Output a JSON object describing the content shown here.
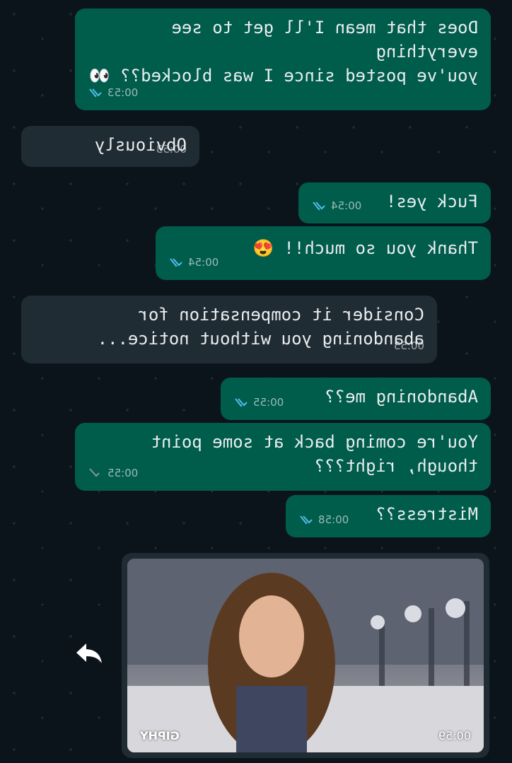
{
  "messages": [
    {
      "side": "out",
      "text": "Does that mean I'll get to see everything\nyou've posted since I was blocked?? 👀",
      "time": "00:53",
      "read": true
    },
    {
      "side": "in",
      "text": "Obviously",
      "time": "00:53"
    },
    {
      "side": "out",
      "text": "Fuck yes!",
      "time": "00:54",
      "read": true
    },
    {
      "side": "out",
      "text": "Thank you so much!! 😍",
      "time": "00:54",
      "read": true
    },
    {
      "side": "in",
      "text": "Consider it compensation for\nabandoning you without notice...",
      "time": "00:55"
    },
    {
      "side": "out",
      "text": "Abandoning me??",
      "time": "00:55",
      "read": true
    },
    {
      "side": "out",
      "text": "You're coming back at some point\nthough, right???",
      "time": "00:55",
      "read": false
    },
    {
      "side": "out",
      "text": "Mistress??",
      "time": "00:58",
      "read": true
    }
  ],
  "gif": {
    "time": "00:59",
    "badge": "GIPHY"
  },
  "icons": {
    "forward": "forward-arrow-icon",
    "read_receipt": "double-check-icon",
    "sent_receipt": "single-check-icon"
  },
  "colors": {
    "outgoing": "#005c4b",
    "incoming": "#202c33",
    "background": "#0b141a",
    "read_tick": "#53bdeb",
    "sent_tick": "#8696a0"
  }
}
